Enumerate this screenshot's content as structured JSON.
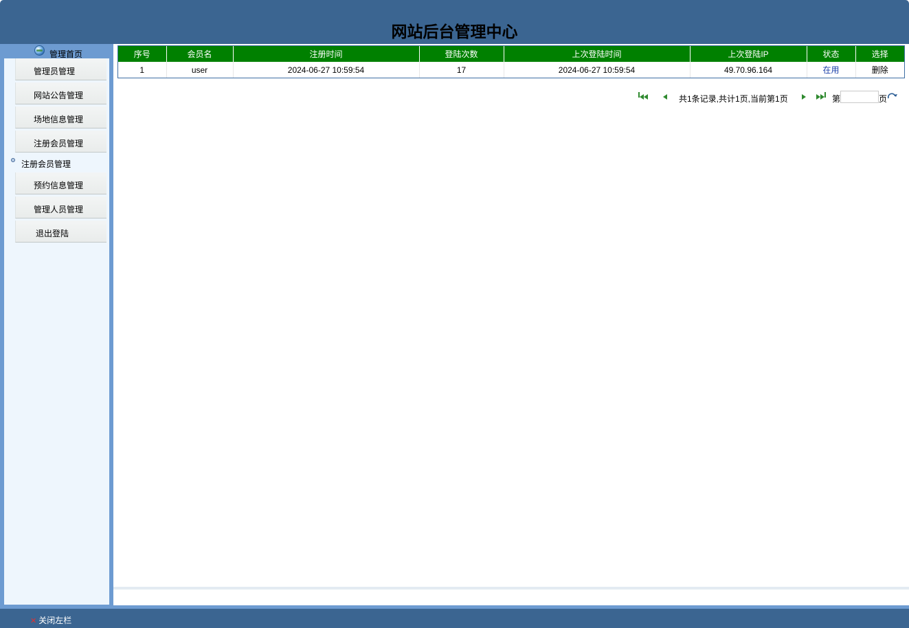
{
  "header": {
    "title": "网站后台管理中心"
  },
  "sidebar": {
    "home_label": "管理首页",
    "items": [
      {
        "label": "管理员管理"
      },
      {
        "label": "网站公告管理"
      },
      {
        "label": "场地信息管理"
      },
      {
        "label": "注册会员管理"
      },
      {
        "label": "预约信息管理"
      },
      {
        "label": "管理人员管理"
      },
      {
        "label": "退出登陆"
      }
    ],
    "submenu_item": {
      "label": "注册会员管理"
    }
  },
  "table": {
    "headers": [
      "序号",
      "会员名",
      "注册时间",
      "登陆次数",
      "上次登陆时间",
      "上次登陆IP",
      "状态",
      "选择"
    ],
    "rows": [
      {
        "index": "1",
        "member_name": "user",
        "register_time": "2024-06-27 10:59:54",
        "login_count": "17",
        "last_login_time": "2024-06-27 10:59:54",
        "last_login_ip": "49.70.96.164",
        "status": "在用",
        "action": "删除"
      }
    ]
  },
  "pager": {
    "info": "共1条记录,共计1页,当前第1页",
    "page_prefix": "第",
    "page_suffix": "页",
    "page_input_value": ""
  },
  "footer": {
    "close_left_label": "关闭左栏"
  },
  "colors": {
    "header_bg": "#3b6591",
    "table_header_bg": "#008000",
    "sidebar_bg": "#eef6fd",
    "frame_blue": "#6d9bd1"
  }
}
